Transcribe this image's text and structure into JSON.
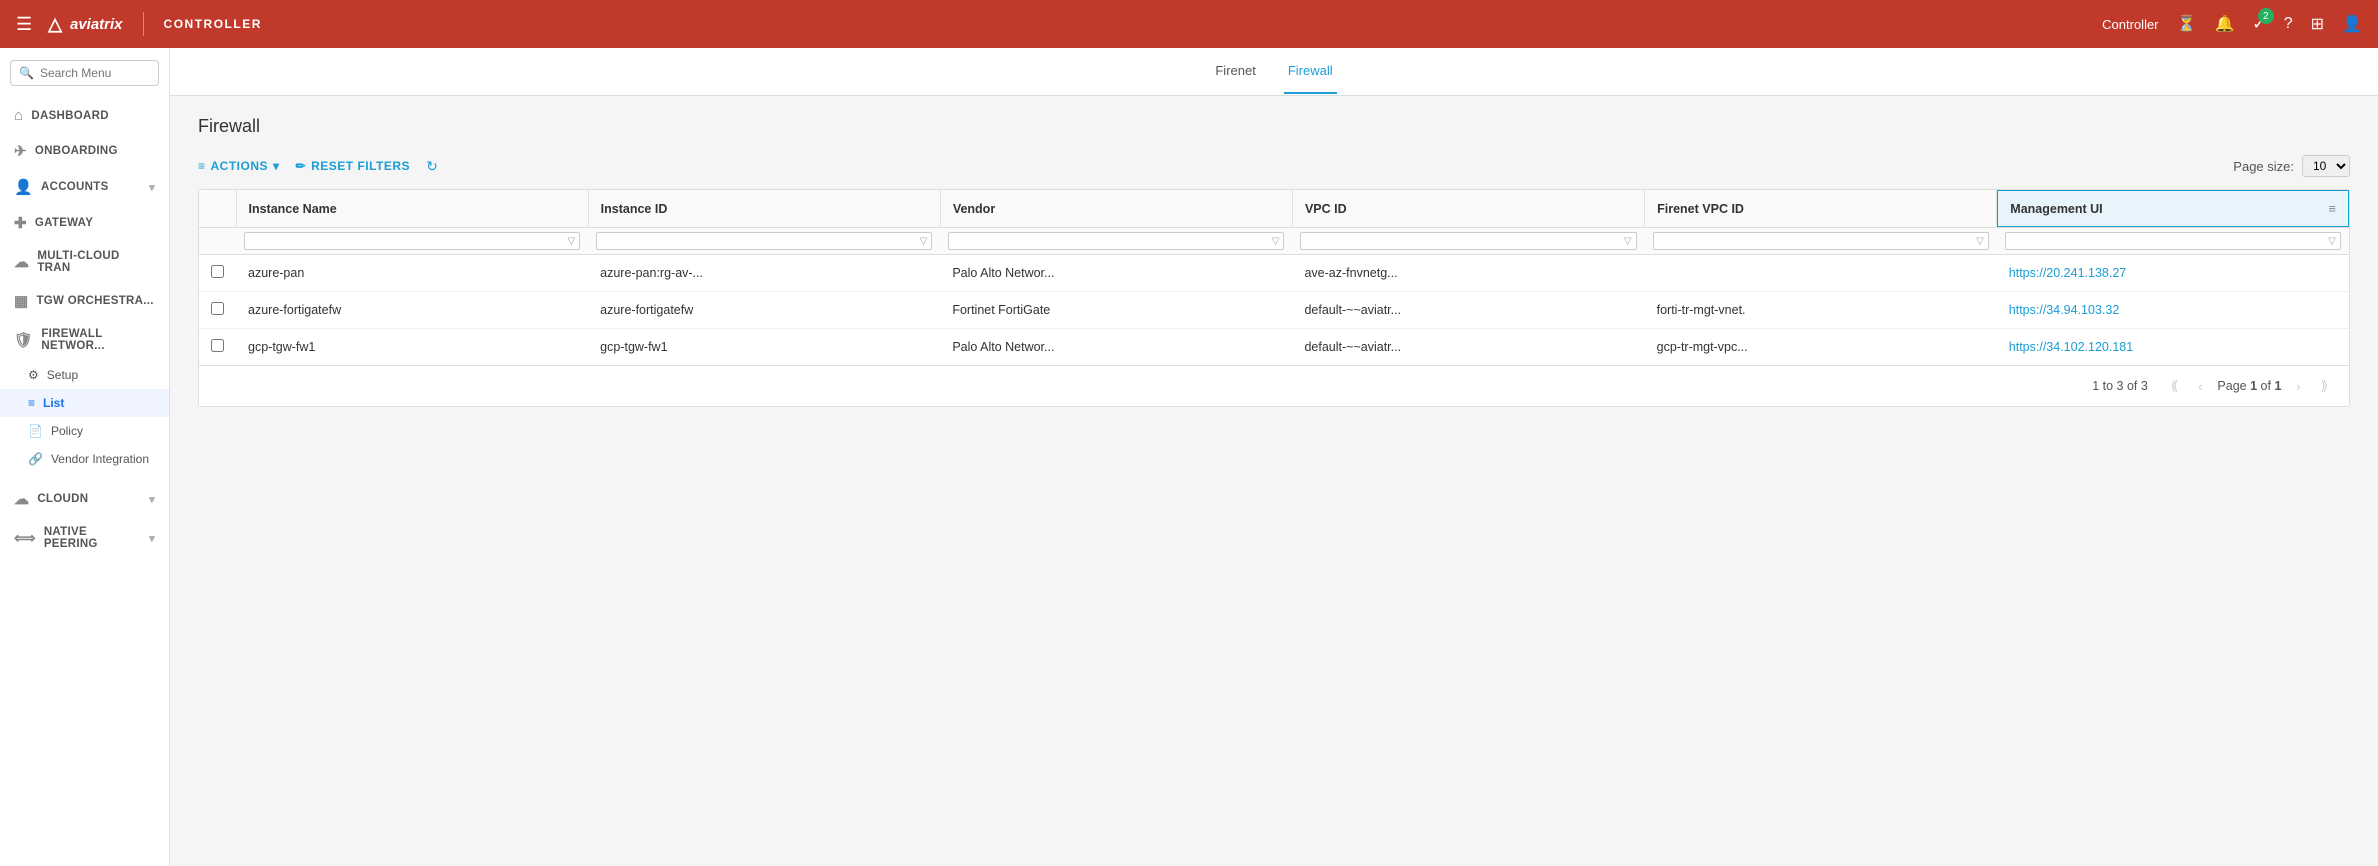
{
  "topnav": {
    "hamburger": "☰",
    "logo_icon": "△",
    "brand": "aviatrix",
    "separator": "|",
    "controller": "Controller",
    "right_label": "Controller",
    "notification_count": "2",
    "icons": {
      "timer": "⏳",
      "bell": "🔔",
      "checkmark": "✅",
      "help": "?",
      "grid": "⊞",
      "user": "👤"
    }
  },
  "sidebar": {
    "search_placeholder": "Search Menu",
    "items": [
      {
        "id": "dashboard",
        "label": "Dashboard",
        "icon": "⌂",
        "has_arrow": false
      },
      {
        "id": "onboarding",
        "label": "Onboarding",
        "icon": "✈",
        "has_arrow": false
      },
      {
        "id": "accounts",
        "label": "Accounts",
        "icon": "👤",
        "has_arrow": true
      },
      {
        "id": "gateway",
        "label": "Gateway",
        "icon": "✚",
        "has_arrow": false
      },
      {
        "id": "multi-cloud",
        "label": "Multi-Cloud Tran",
        "icon": "☁",
        "has_arrow": false
      },
      {
        "id": "tgw",
        "label": "TGW Orchestra...",
        "icon": "▦",
        "has_arrow": false
      },
      {
        "id": "firewall",
        "label": "Firewall Networ...",
        "icon": "🛡",
        "has_arrow": false
      }
    ],
    "sub_items": [
      {
        "id": "setup",
        "label": "Setup",
        "icon": "⚙"
      },
      {
        "id": "list",
        "label": "List",
        "icon": "≡",
        "active": true
      },
      {
        "id": "policy",
        "label": "Policy",
        "icon": "📄"
      },
      {
        "id": "vendor",
        "label": "Vendor Integration",
        "icon": "🔗"
      }
    ],
    "bottom_items": [
      {
        "id": "cloudn",
        "label": "CloudN",
        "icon": "☁",
        "has_arrow": true
      },
      {
        "id": "native-peering",
        "label": "Native Peering",
        "icon": "⟺",
        "has_arrow": true
      }
    ]
  },
  "tabs": [
    {
      "id": "firenet",
      "label": "Firenet",
      "active": false
    },
    {
      "id": "firewall",
      "label": "Firewall",
      "active": true
    }
  ],
  "page": {
    "title": "Firewall",
    "toolbar": {
      "actions_label": "Actions",
      "reset_label": "Reset Filters",
      "page_size_label": "Page size:",
      "page_size_value": "10"
    },
    "table": {
      "columns": [
        {
          "id": "instance_name",
          "label": "Instance Name"
        },
        {
          "id": "instance_id",
          "label": "Instance ID"
        },
        {
          "id": "vendor",
          "label": "Vendor"
        },
        {
          "id": "vpc_id",
          "label": "VPC ID"
        },
        {
          "id": "firenet_vpc_id",
          "label": "Firenet VPC ID"
        },
        {
          "id": "management_ui",
          "label": "Management UI",
          "active": true
        }
      ],
      "rows": [
        {
          "instance_name": "azure-pan",
          "instance_id": "azure-pan:rg-av-...",
          "vendor": "Palo Alto Networ...",
          "vpc_id": "ave-az-fnvnetg...",
          "firenet_vpc_id": "",
          "management_ui": "https://20.241.138.27"
        },
        {
          "instance_name": "azure-fortigatefw",
          "instance_id": "azure-fortigatefw",
          "vendor": "Fortinet FortiGate",
          "vpc_id": "default-~~aviatr...",
          "firenet_vpc_id": "forti-tr-mgt-vnet.",
          "management_ui": "https://34.94.103.32"
        },
        {
          "instance_name": "gcp-tgw-fw1",
          "instance_id": "gcp-tgw-fw1",
          "vendor": "Palo Alto Networ...",
          "vpc_id": "default-~~aviatr...",
          "firenet_vpc_id": "gcp-tr-mgt-vpc...",
          "management_ui": "https://34.102.120.181"
        }
      ]
    },
    "pagination": {
      "info": "1 to 3 of 3",
      "page_label": "Page",
      "current_page": "1",
      "of_label": "of",
      "total_pages": "1"
    }
  }
}
